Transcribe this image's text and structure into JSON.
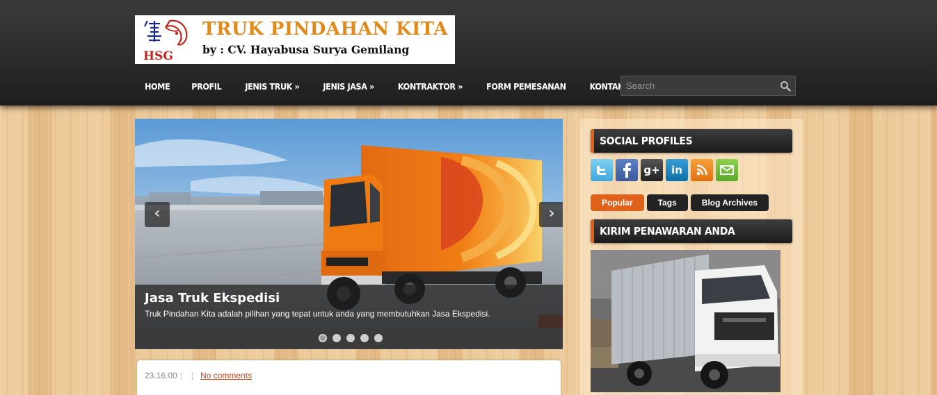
{
  "header": {
    "logo": {
      "emblem_letters": "HSG",
      "title": "TRUK PINDAHAN KITA",
      "subtitle": "by : CV. Hayabusa Surya Gemilang"
    },
    "nav": [
      {
        "label": "HOME"
      },
      {
        "label": "PROFIL"
      },
      {
        "label": "JENIS TRUK »"
      },
      {
        "label": "JENIS JASA »"
      },
      {
        "label": "KONTRAKTOR »"
      },
      {
        "label": "FORM PEMESANAN"
      },
      {
        "label": "KONTAK KAMI"
      }
    ],
    "search": {
      "placeholder": "Search",
      "icon": "magnifier-icon"
    }
  },
  "slider": {
    "caption_title": "Jasa Truk Ekspedisi",
    "caption_text": "Truk Pindahan Kita adalah pilihan yang tepat untuk anda yang membutuhkan Jasa Ekspedisi.",
    "slide_count": 5,
    "active_slide": 1,
    "prev_icon": "chevron-left-icon",
    "next_icon": "chevron-right-icon"
  },
  "post": {
    "date": "23.16.00",
    "comments": "No comments"
  },
  "sidebar": {
    "social_title": "SOCIAL PROFILES",
    "social_icons": [
      "twitter-icon",
      "facebook-icon",
      "google-plus-icon",
      "linkedin-icon",
      "rss-icon",
      "email-icon"
    ],
    "tabs": [
      {
        "label": "Popular",
        "active": true
      },
      {
        "label": "Tags",
        "active": false
      },
      {
        "label": "Blog Archives",
        "active": false
      }
    ],
    "offer_title": "KIRIM PENAWARAN ANDA"
  },
  "colors": {
    "accent": "#e0621a",
    "header_bg": "#2a2a2a",
    "logo_title": "#e08a1e",
    "link": "#c0491d"
  }
}
